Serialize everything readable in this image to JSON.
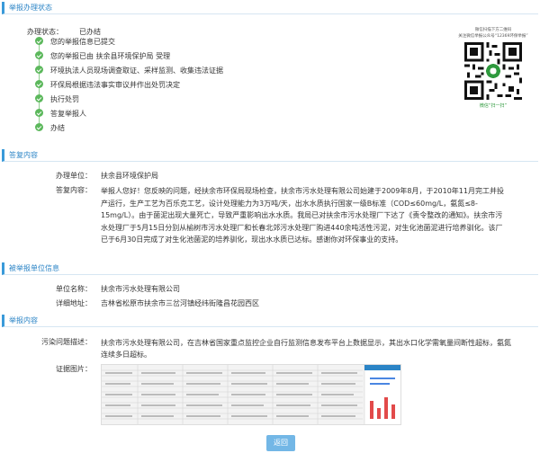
{
  "sections": {
    "status": "举报办理状态",
    "reply": "答复内容",
    "reported": "被举报单位信息",
    "report": "举报内容"
  },
  "status": {
    "label": "办理状态：",
    "value": "已办结"
  },
  "steps": [
    "您的举报信息已提交",
    "您的举报已由 扶余县环境保护局 受理",
    "环境执法人员现场调查取证、采样监测、收集违法证据",
    "环保局根据违法事实审议并作出处罚决定",
    "执行处罚",
    "答复举报人",
    "办结"
  ],
  "qr": {
    "title_line1": "微信扫描下方二维码",
    "title_line2": "关注微信举报公众号“12369环保举报”",
    "caption": "微信“扫一扫”"
  },
  "reply": {
    "unit_label": "办理单位：",
    "unit_value": "扶余县环境保护局",
    "content_label": "答复内容：",
    "content_value": "举报人您好！您反映的问题，经扶余市环保局现场检查，扶余市污水处理有限公司始建于2009年8月，于2010年11月完工并投产运行，生产工艺为百乐克工艺，设计处理能力为3万吨/天，出水水质执行国家一级B标准（COD≤60mg/L，氨氮≤8-15mg/L）。由于菌泥出现大量死亡，导致严重影响出水水质。我局已对扶余市污水处理厂下达了《责令整改的通知》。扶余市污水处理厂于5月15日分别从榆树市污水处理厂和长春北郊污水处理厂购进440余吨活性污泥，对生化池菌泥进行培养驯化。该厂已于6月30日完成了对生化池菌泥的培养驯化，现出水水质已达标。感谢你对环保事业的支持。"
  },
  "reported": {
    "name_label": "单位名称：",
    "name_value": "扶余市污水处理有限公司",
    "address_label": "详细地址：",
    "address_value": "吉林省松原市扶余市三岔河镇经纬街隆昌花园西区"
  },
  "report": {
    "desc_label": "污染问题描述：",
    "desc_value": "扶余市污水处理有限公司，在吉林省国家重点监控企业自行监测信息发布平台上数据显示，其出水口化学需氧量间断性超标，氨氮连续多日超标。",
    "evidence_label": "证据图片："
  },
  "buttons": {
    "return": "返回"
  },
  "colors": {
    "accent": "#3a9ad9",
    "success": "#5cb85c",
    "button": "#73b7e6"
  }
}
